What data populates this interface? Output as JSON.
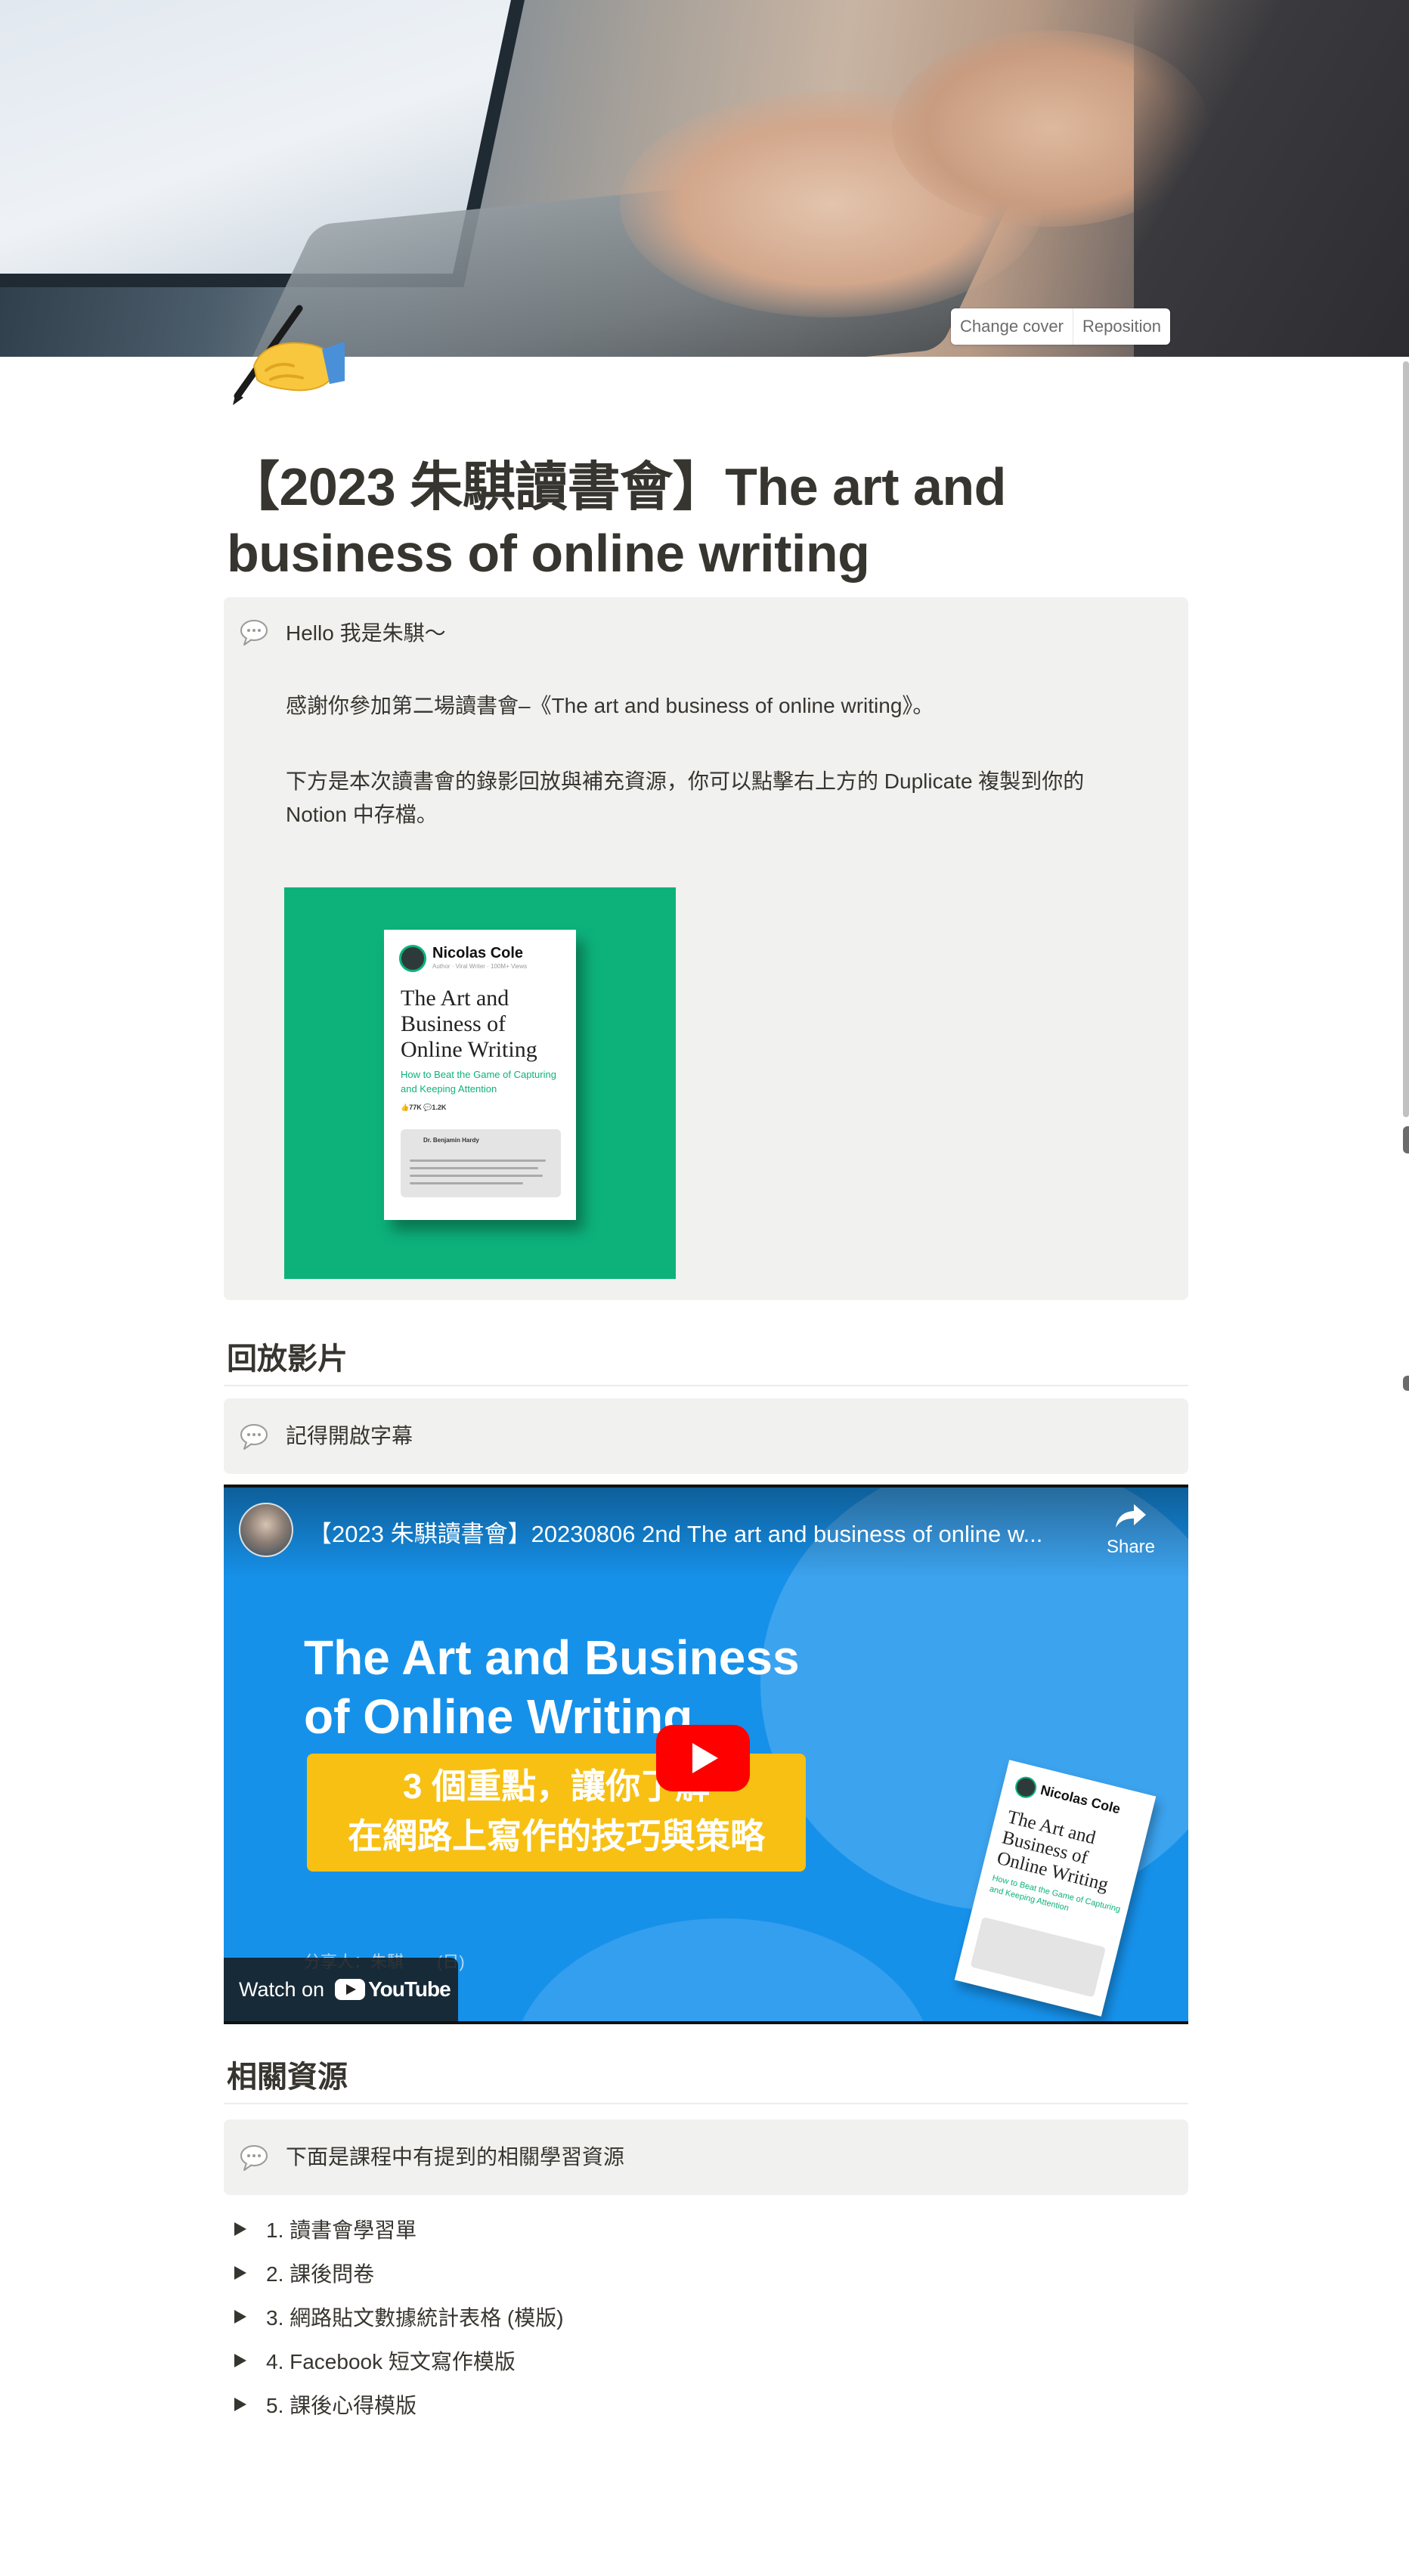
{
  "cover": {
    "change_cover_label": "Change cover",
    "reposition_label": "Reposition"
  },
  "page": {
    "icon": "writing-hand-icon",
    "title": "【2023 朱騏讀書會】The art and business of online writing"
  },
  "intro_callout": {
    "icon": "speech-bubble-icon",
    "line1": "Hello 我是朱騏～",
    "line2": "感謝你參加第二場讀書會–《The art and business of online writing》。",
    "line3": "下方是本次讀書會的錄影回放與補充資源，你可以點擊右上方的 Duplicate 複製到你的 Notion 中存檔。",
    "book_image": {
      "author": "Nicolas Cole",
      "author_sub": "Author · Viral Writer · 100M+ Views",
      "title": "The Art and Business of Online Writing",
      "subtitle": "How to Beat the Game of Capturing and Keeping Attention",
      "stats": "👍77K   💬1.2K",
      "quote_author": "Dr. Benjamin Hardy"
    }
  },
  "replay_section": {
    "heading": "回放影片",
    "callout_text": "記得開啟字幕",
    "callout_icon": "speech-bubble-icon"
  },
  "video": {
    "title": "【2023 朱騏讀書會】20230806 2nd The art and business of online w...",
    "share_label": "Share",
    "headline_line1": "The Art and Business",
    "headline_line2": "of Online Writing",
    "box_line1": "3 個重點，讓你了解",
    "box_line2": "在網路上寫作的技巧與策略",
    "watch_on_label": "Watch on",
    "youtube_label": "YouTube",
    "book_author": "Nicolas Cole",
    "book_title": "The Art and Business of Online Writing",
    "book_subtitle": "How to Beat the Game of Capturing and Keeping Attention",
    "footer_text": "分享人：朱騏　　(日)"
  },
  "resources_section": {
    "heading": "相關資源",
    "callout_text": "下面是課程中有提到的相關學習資源",
    "callout_icon": "speech-bubble-icon",
    "items": [
      "1. 讀書會學習單",
      "2. 課後問卷",
      "3. 網路貼文數據統計表格 (模版)",
      "4. Facebook 短文寫作模版",
      "5. 課後心得模版"
    ]
  },
  "colors": {
    "text": "#37352f",
    "callout_bg": "#f1f1ef",
    "book_green": "#0db27b",
    "video_blue": "#1691ea",
    "highlight_yellow": "#f7c013",
    "youtube_red": "#ff0000"
  }
}
